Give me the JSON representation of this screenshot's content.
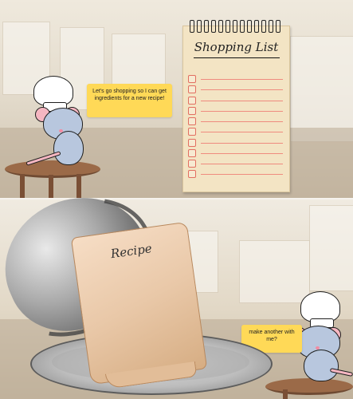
{
  "top_scene": {
    "speech_text": "Let's go shopping so I can get ingredients for a new recipe!",
    "notepad_title": "Shopping List",
    "shopping_items": [
      "",
      "",
      "",
      "",
      "",
      "",
      "",
      "",
      "",
      "",
      "",
      ""
    ]
  },
  "bottom_scene": {
    "recipe_title": "Recipe",
    "speech_text": "make another with me?"
  },
  "colors": {
    "speech_background": "#ffd957",
    "notepad_background": "#f3e4c4",
    "notepad_rule": "#ef8b7f",
    "recipe_paper": "#e9c8a8",
    "mouse_body": "#b8c7de",
    "mouse_ear": "#f5b6c1"
  },
  "icons": {
    "chef_mouse": "chef-mouse-icon",
    "cloche": "cloche-icon",
    "recipe_scroll": "recipe-scroll-icon",
    "shopping_notepad": "shopping-list-notepad-icon"
  }
}
